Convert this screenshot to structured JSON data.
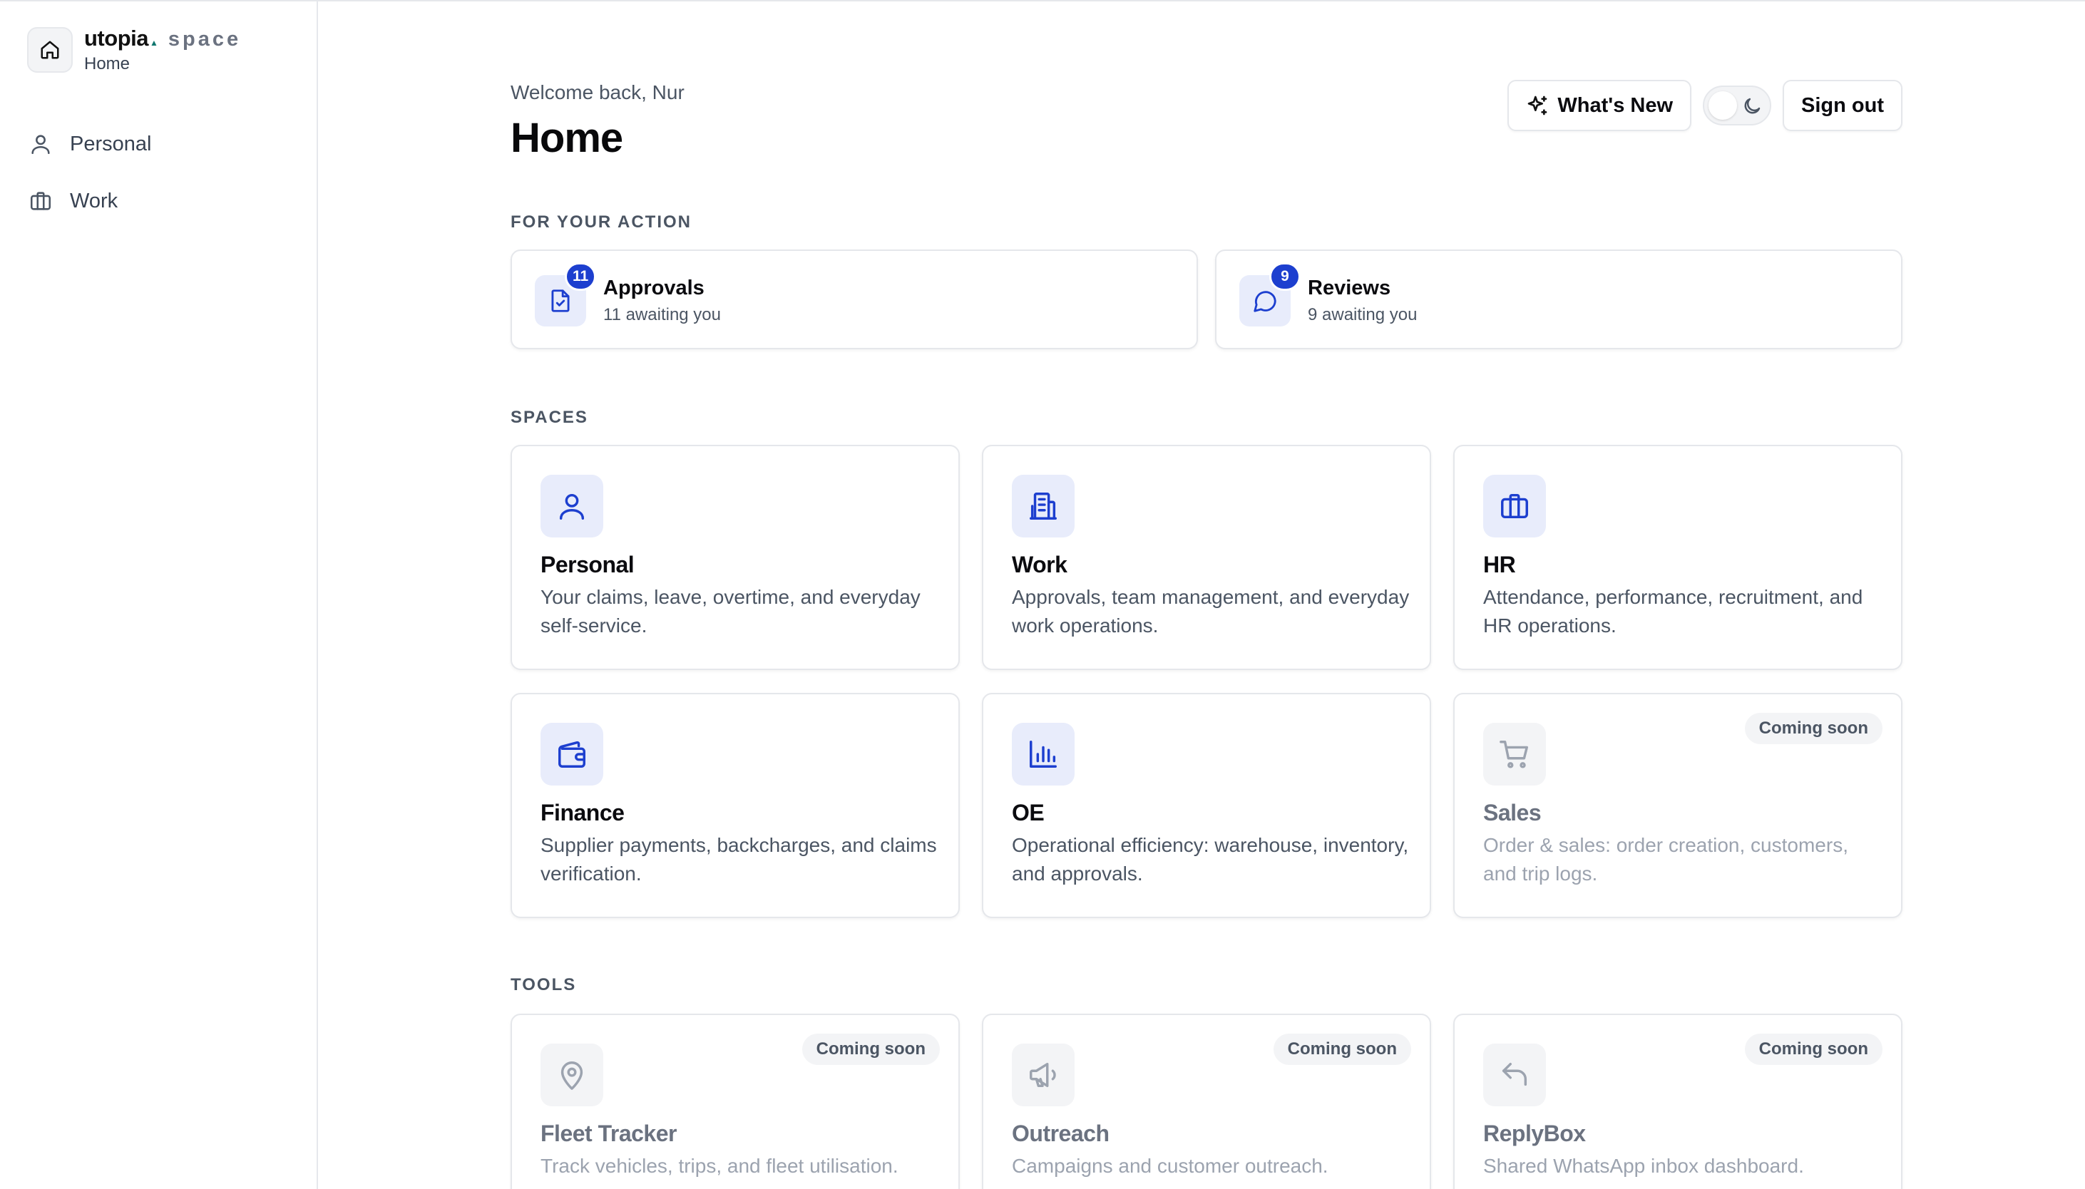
{
  "brand": {
    "name": "utopia",
    "space": "space",
    "subtitle": "Home"
  },
  "sidebar": {
    "items": [
      {
        "label": "Personal",
        "icon": "user-icon"
      },
      {
        "label": "Work",
        "icon": "briefcase-icon"
      }
    ]
  },
  "header": {
    "welcome": "Welcome back, Nur",
    "title": "Home",
    "whats_new": "What's New",
    "sign_out": "Sign out"
  },
  "for_your_action": {
    "label": "FOR YOUR ACTION",
    "items": [
      {
        "title": "Approvals",
        "subtitle": "11 awaiting you",
        "badge": "11",
        "icon": "file-check-icon"
      },
      {
        "title": "Reviews",
        "subtitle": "9 awaiting you",
        "badge": "9",
        "icon": "message-circle-icon"
      }
    ]
  },
  "spaces": {
    "label": "SPACES",
    "items": [
      {
        "title": "Personal",
        "description": "Your claims, leave, overtime, and everyday self-service.",
        "icon": "user-icon"
      },
      {
        "title": "Work",
        "description": "Approvals, team management, and everyday work operations.",
        "icon": "building-icon"
      },
      {
        "title": "HR",
        "description": "Attendance, performance, recruitment, and HR operations.",
        "icon": "briefcase-icon"
      },
      {
        "title": "Finance",
        "description": "Supplier payments, backcharges, and claims verification.",
        "icon": "wallet-icon"
      },
      {
        "title": "OE",
        "description": "Operational efficiency: warehouse, inventory, and approvals.",
        "icon": "bar-chart-icon"
      },
      {
        "title": "Sales",
        "description": "Order & sales: order creation, customers, and trip logs.",
        "icon": "cart-icon",
        "badge": "Coming soon"
      }
    ]
  },
  "tools": {
    "label": "TOOLS",
    "items": [
      {
        "title": "Fleet Tracker",
        "description": "Track vehicles, trips, and fleet utilisation.",
        "icon": "map-pin-icon",
        "badge": "Coming soon"
      },
      {
        "title": "Outreach",
        "description": "Campaigns and customer outreach.",
        "icon": "megaphone-icon",
        "badge": "Coming soon"
      },
      {
        "title": "ReplyBox",
        "description": "Shared WhatsApp inbox dashboard.",
        "icon": "reply-icon",
        "badge": "Coming soon"
      }
    ]
  },
  "colors": {
    "accent": "#1d3fcf",
    "icon_bg": "#e8ecfb",
    "muted": "#4b5563"
  }
}
